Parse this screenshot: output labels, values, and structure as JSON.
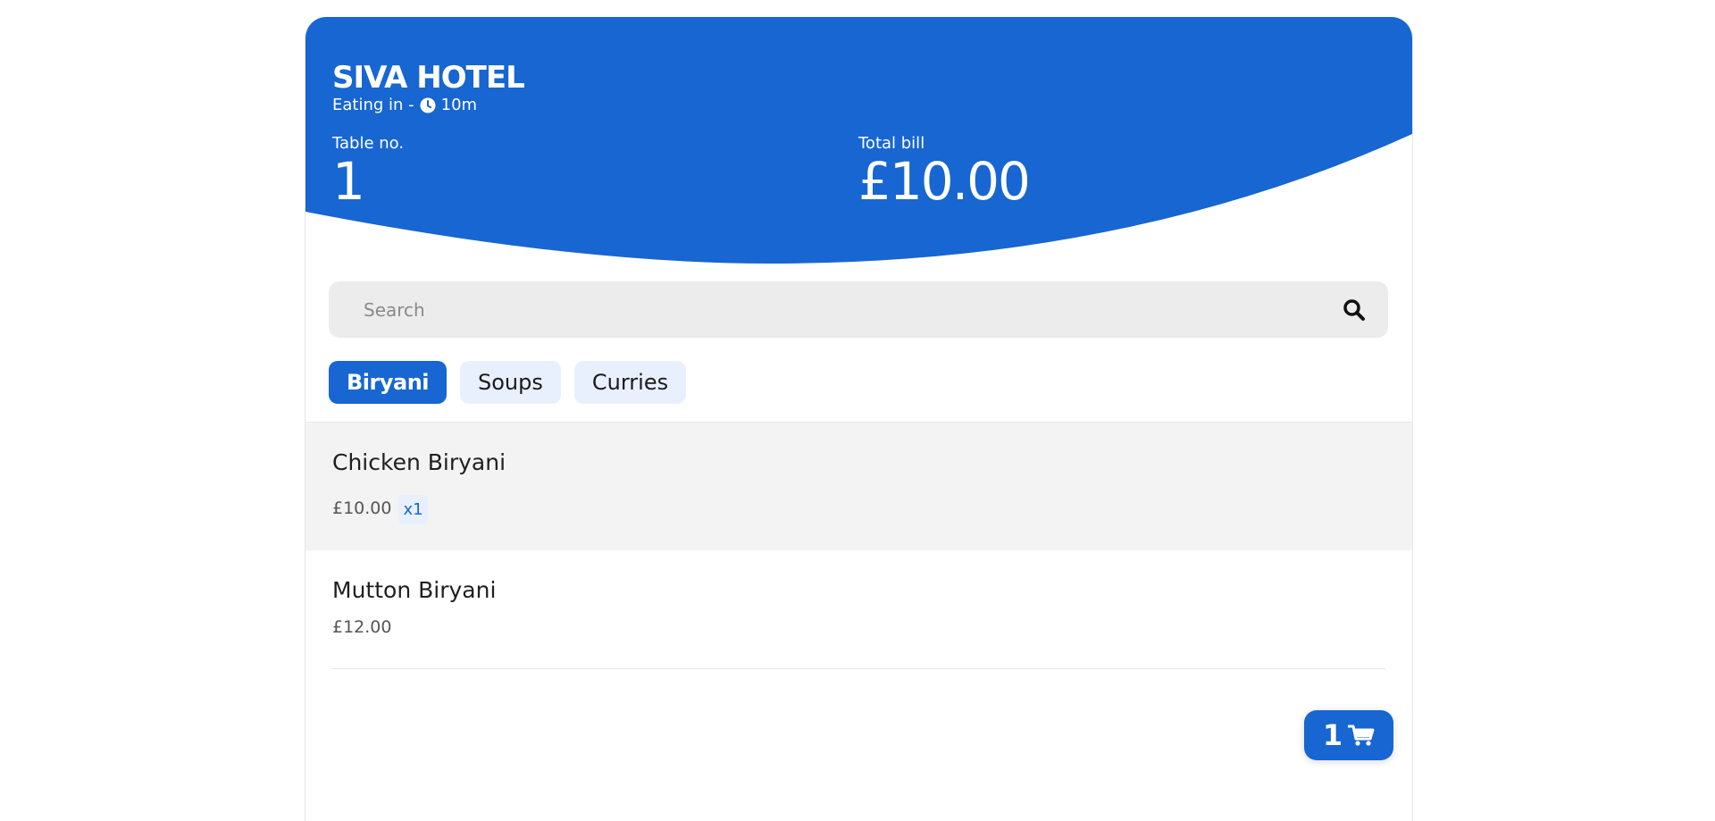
{
  "colors": {
    "primary": "#1766d1",
    "tab_inactive_bg": "#e8f0fe",
    "search_bg": "#ececec",
    "selected_row_bg": "#f3f3f3"
  },
  "header": {
    "hotel_name": "SIVA HOTEL",
    "dining_mode": "Eating in -",
    "elapsed_time": "10m",
    "table_label": "Table no.",
    "table_value": "1",
    "bill_label": "Total bill",
    "bill_value": "£10.00"
  },
  "search": {
    "placeholder": "Search",
    "value": ""
  },
  "tabs": [
    {
      "label": "Biryani",
      "active": true
    },
    {
      "label": "Soups",
      "active": false
    },
    {
      "label": "Curries",
      "active": false
    }
  ],
  "menu_items": [
    {
      "name": "Chicken Biryani",
      "price": "£10.00",
      "quantity": "x1",
      "selected": true
    },
    {
      "name": "Mutton Biryani",
      "price": "£12.00",
      "quantity": "",
      "selected": false
    }
  ],
  "cart": {
    "count": "1",
    "icon": "cart-icon"
  }
}
